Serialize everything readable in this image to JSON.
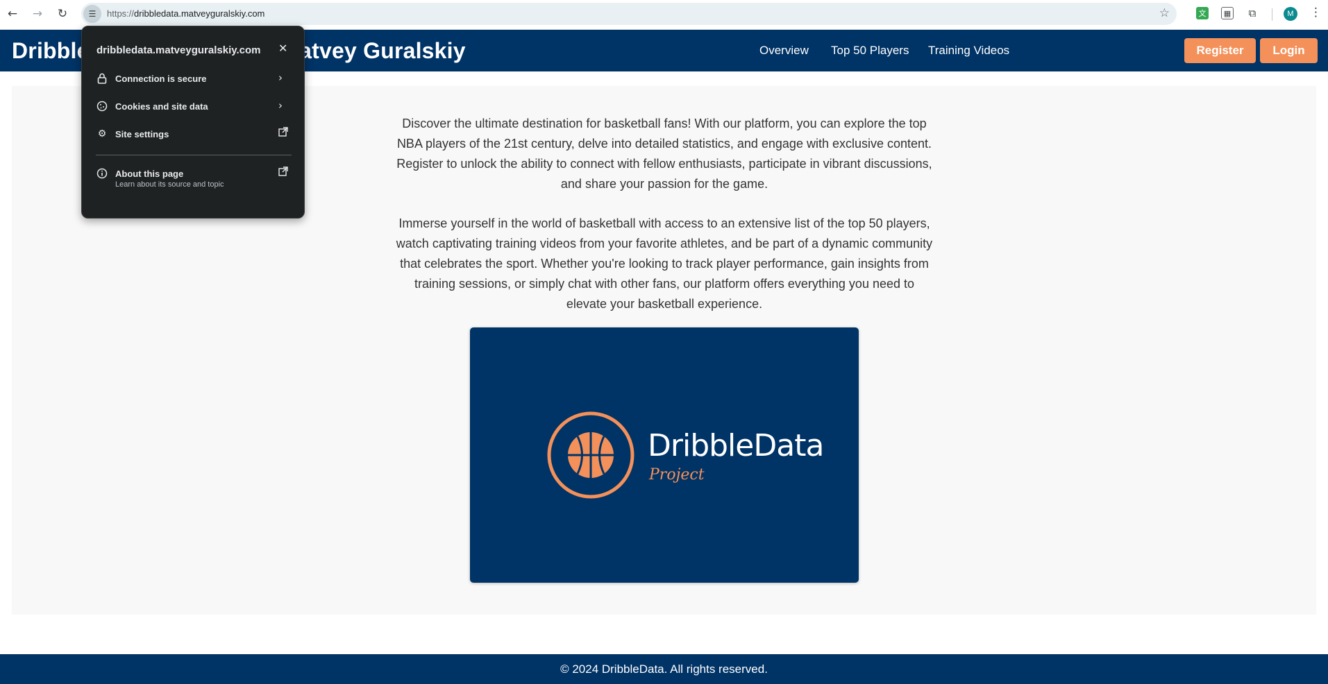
{
  "browser": {
    "back_icon": "arrow-left-icon",
    "forward_icon": "arrow-right-icon",
    "reload_icon": "reload-icon",
    "url_scheme": "https://",
    "url_host": "dribbledata.matveyguralskiy.com",
    "profile_initial": "M"
  },
  "header": {
    "title": "DribbleData - Created by Matvey Guralskiy",
    "nav": [
      "Overview",
      "Top 50 Players",
      "Training Videos"
    ],
    "register_label": "Register",
    "login_label": "Login"
  },
  "main": {
    "paragraph_1": "Discover the ultimate destination for basketball fans! With our platform, you can explore the top NBA players of the 21st century, delve into detailed statistics, and engage with exclusive content. Register to unlock the ability to connect with fellow enthusiasts, participate in vibrant discussions, and share your passion for the game.",
    "paragraph_2": "Immerse yourself in the world of basketball with access to an extensive list of the top 50 players, watch captivating training videos from your favorite athletes, and be part of a dynamic community that celebrates the sport. Whether you're looking to track player performance, gain insights from training sessions, or simply chat with other fans, our platform offers everything you need to elevate your basketball experience.",
    "logo_text": "DribbleData",
    "logo_subtext": "Project"
  },
  "footer": {
    "text": "© 2024 DribbleData. All rights reserved."
  },
  "popup": {
    "domain": "dribbledata.matveyguralskiy.com",
    "rows": [
      {
        "label": "Connection is secure",
        "icon": "lock-icon"
      },
      {
        "label": "Cookies and site data",
        "icon": "cookie-icon"
      },
      {
        "label": "Site settings",
        "icon": "gear-icon"
      },
      {
        "label": "About this page",
        "sublabel": "Learn about its source and topic",
        "icon": "info-icon"
      }
    ]
  },
  "colors": {
    "brand_navy": "#003366",
    "accent_orange": "#f4915a",
    "popup_bg": "#1f2223"
  }
}
